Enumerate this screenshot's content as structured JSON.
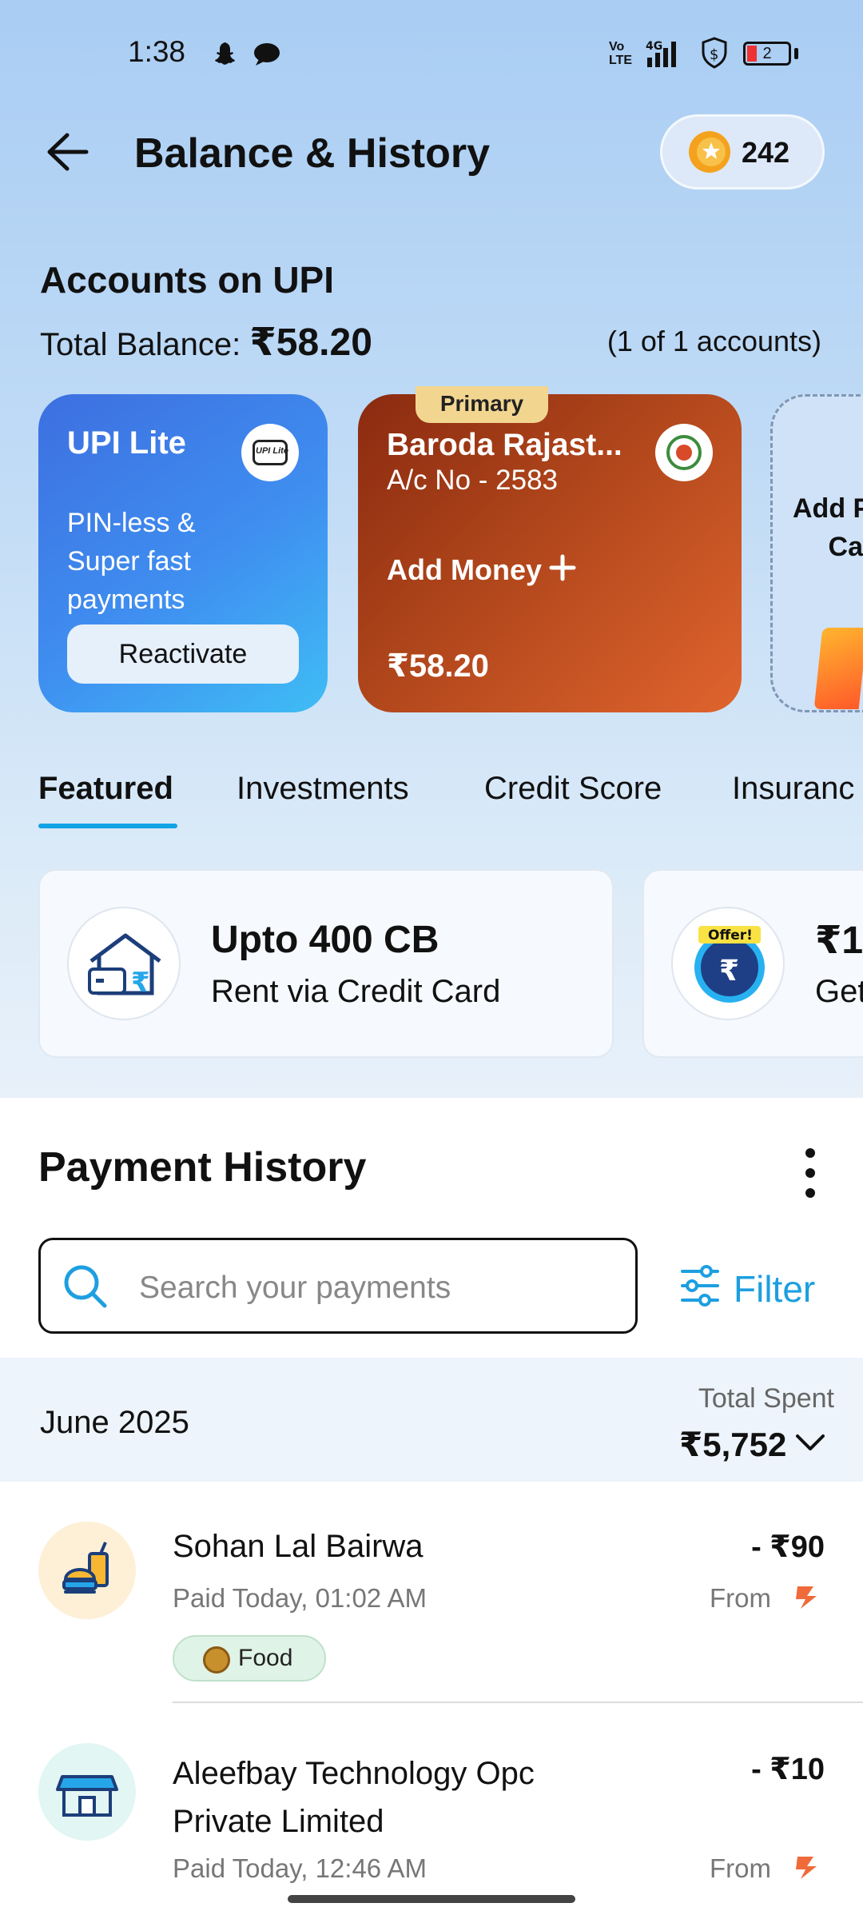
{
  "status_bar": {
    "time": "1:38",
    "battery": "2",
    "network": "4G"
  },
  "header": {
    "title": "Balance & History",
    "coins": "242"
  },
  "accounts": {
    "title": "Accounts on UPI",
    "total_label": "Total Balance: ",
    "total_value": "₹58.20",
    "count": "(1 of 1 accounts)"
  },
  "cards": {
    "lite": {
      "title": "UPI Lite",
      "desc_1": "PIN-less &",
      "desc_2": "Super fast",
      "desc_3": "payments",
      "button": "Reactivate",
      "logo_text": "UPI Lite"
    },
    "bank": {
      "tag": "Primary",
      "name": "Baroda Rajast...",
      "acc_no": "A/c No - 2583",
      "add_money": "Add Money",
      "balance": "₹58.20"
    },
    "add": {
      "line1": "Add P",
      "line2": "Ca"
    }
  },
  "tabs": [
    "Featured",
    "Investments",
    "Credit Score",
    "Insuranc"
  ],
  "featured": [
    {
      "title": "Upto 400 CB",
      "subtitle": "Rent via Credit Card"
    },
    {
      "title": "₹1",
      "subtitle": "Get",
      "badge": "Offer!"
    }
  ],
  "payment_history": {
    "title": "Payment History",
    "search_placeholder": "Search your payments",
    "filter_label": "Filter",
    "month": "June 2025",
    "total_spent_label": "Total Spent",
    "total_spent_value": "₹5,752",
    "transactions": [
      {
        "name": "Sohan Lal Bairwa",
        "name_2": "",
        "time": "Paid Today, 01:02 AM",
        "amount": "- ₹90",
        "from": "From",
        "category": "Food"
      },
      {
        "name": "Aleefbay Technology Opc",
        "name_2": "Private Limited",
        "time": "Paid Today, 12:46 AM",
        "amount": "- ₹10",
        "from": "From"
      }
    ]
  },
  "colors": {
    "accent": "#12a3e4",
    "bank_card": "#b0461b",
    "lite_card": "#3f8ef0"
  }
}
